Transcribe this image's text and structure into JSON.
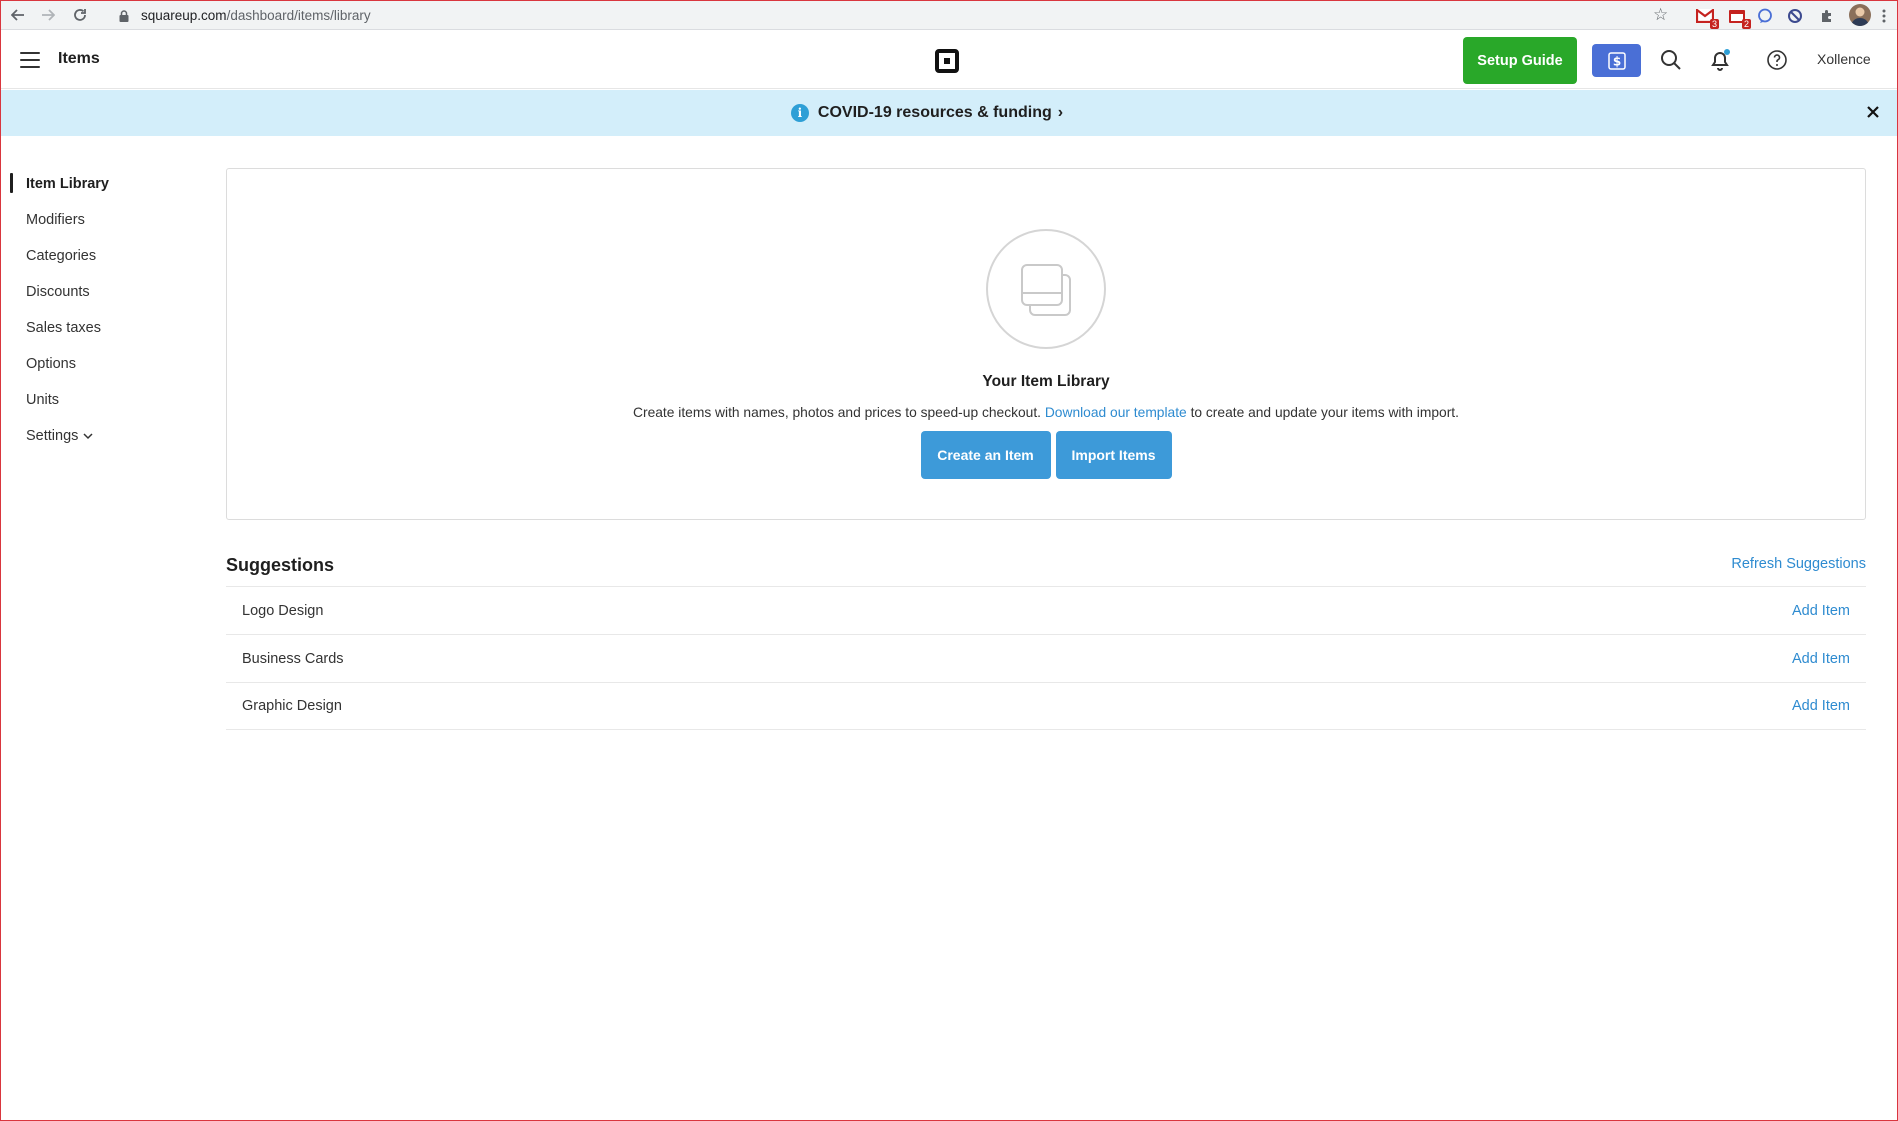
{
  "browser": {
    "url_host": "squareup.com",
    "url_path": "/dashboard/items/library",
    "extensions": [
      {
        "name": "gmail-icon",
        "badge": "3",
        "color": "#c5221f"
      },
      {
        "name": "calendar-extension-icon",
        "badge": "2",
        "color": "#c5221f"
      },
      {
        "name": "chat-extension-icon",
        "badge": "",
        "color": "#4a6fd6"
      },
      {
        "name": "block-extension-icon",
        "badge": "",
        "color": "#3c4a8f"
      },
      {
        "name": "puzzle-extension-icon",
        "badge": "",
        "color": "#5f6368"
      }
    ]
  },
  "header": {
    "title": "Items",
    "setup_guide_label": "Setup Guide",
    "user_name": "Xollence",
    "colors": {
      "setup_guide": "#29a829",
      "dollar_button": "#4a6fd6",
      "notification_dot": "#2e9fd6"
    }
  },
  "banner": {
    "text": "COVID-19 resources & funding",
    "chevron": "›",
    "info_glyph": "i"
  },
  "sidebar": {
    "items": [
      {
        "label": "Item Library",
        "active": true
      },
      {
        "label": "Modifiers",
        "active": false
      },
      {
        "label": "Categories",
        "active": false
      },
      {
        "label": "Discounts",
        "active": false
      },
      {
        "label": "Sales taxes",
        "active": false
      },
      {
        "label": "Options",
        "active": false
      },
      {
        "label": "Units",
        "active": false
      },
      {
        "label": "Settings",
        "active": false
      }
    ]
  },
  "library": {
    "title": "Your Item Library",
    "desc_before": "Create items with names, photos and prices to speed-up checkout. ",
    "desc_link": "Download our template",
    "desc_after": " to create and update your items with import.",
    "create_label": "Create an Item",
    "import_label": "Import Items",
    "button_color": "#3d9ad9",
    "link_color": "#2e8bd0"
  },
  "suggestions": {
    "title": "Suggestions",
    "refresh_label": "Refresh Suggestions",
    "rows": [
      {
        "name": "Logo Design",
        "action": "Add Item"
      },
      {
        "name": "Business Cards",
        "action": "Add Item"
      },
      {
        "name": "Graphic Design",
        "action": "Add Item"
      }
    ]
  }
}
